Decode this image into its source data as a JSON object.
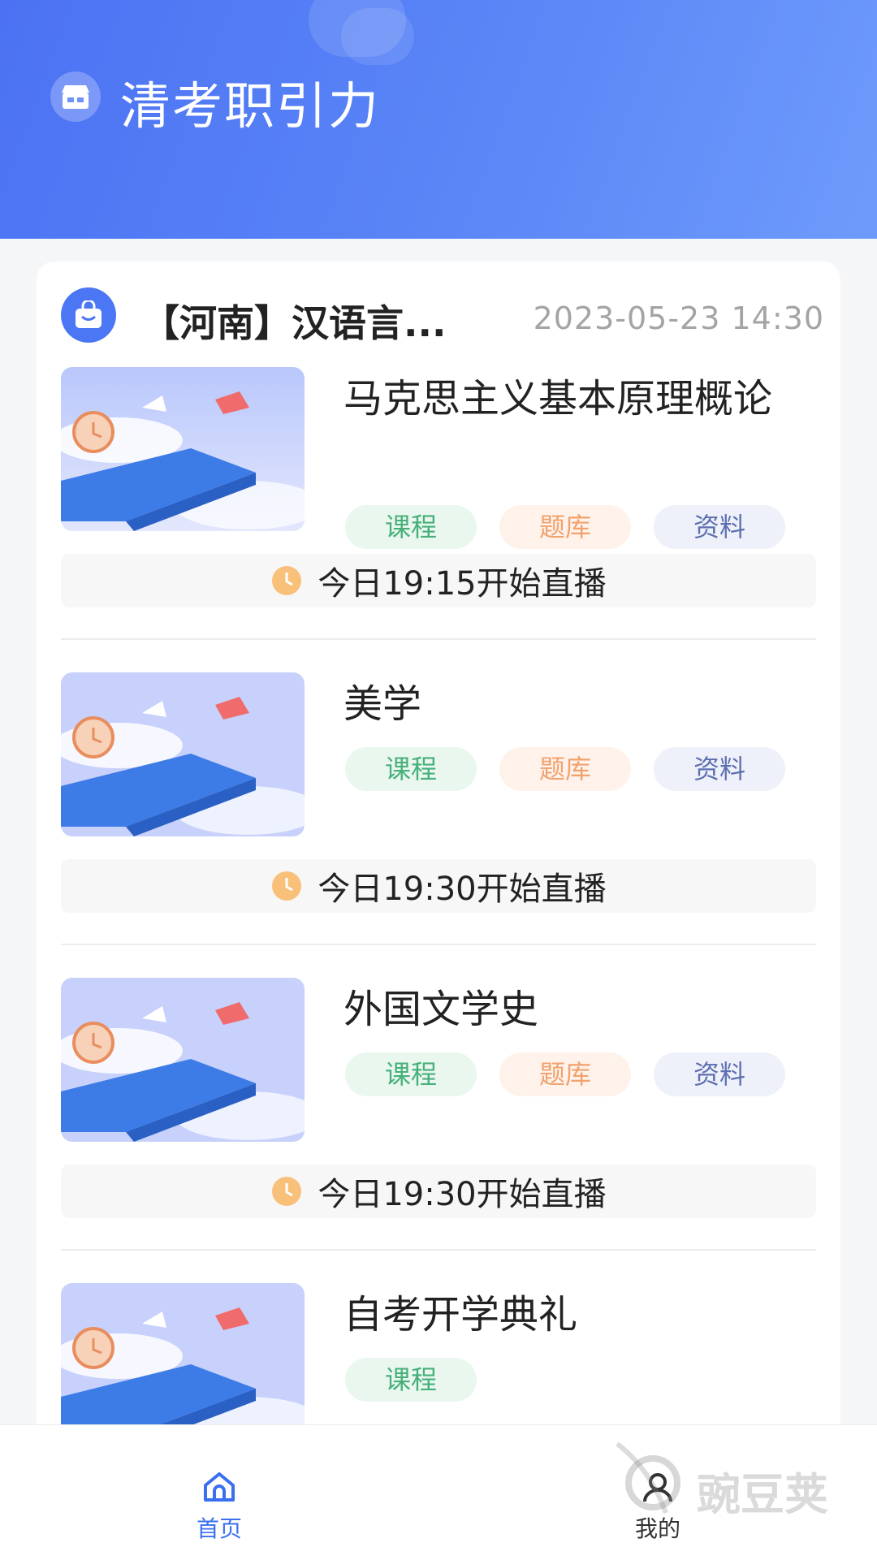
{
  "app": {
    "title": "清考职引力"
  },
  "card": {
    "title": "【河南】汉语言...",
    "date": "2023-05-23 14:30"
  },
  "courses": [
    {
      "name": "马克思主义基本原理概论",
      "tags": [
        "课程",
        "题库",
        "资料"
      ],
      "live": "今日19:15开始直播"
    },
    {
      "name": "美学",
      "tags": [
        "课程",
        "题库",
        "资料"
      ],
      "live": "今日19:30开始直播"
    },
    {
      "name": "外国文学史",
      "tags": [
        "课程",
        "题库",
        "资料"
      ],
      "live": "今日19:30开始直播"
    },
    {
      "name": "自考开学典礼",
      "tags": [
        "课程"
      ]
    }
  ],
  "tabbar": {
    "home": "首页",
    "mine": "我的",
    "active_color": "#3a6ff0",
    "inactive_color": "#333333"
  },
  "watermark": "豌豆荚",
  "colors": {
    "brand": "#4c72f3",
    "header_gradient_end": "#6e9bfb"
  }
}
